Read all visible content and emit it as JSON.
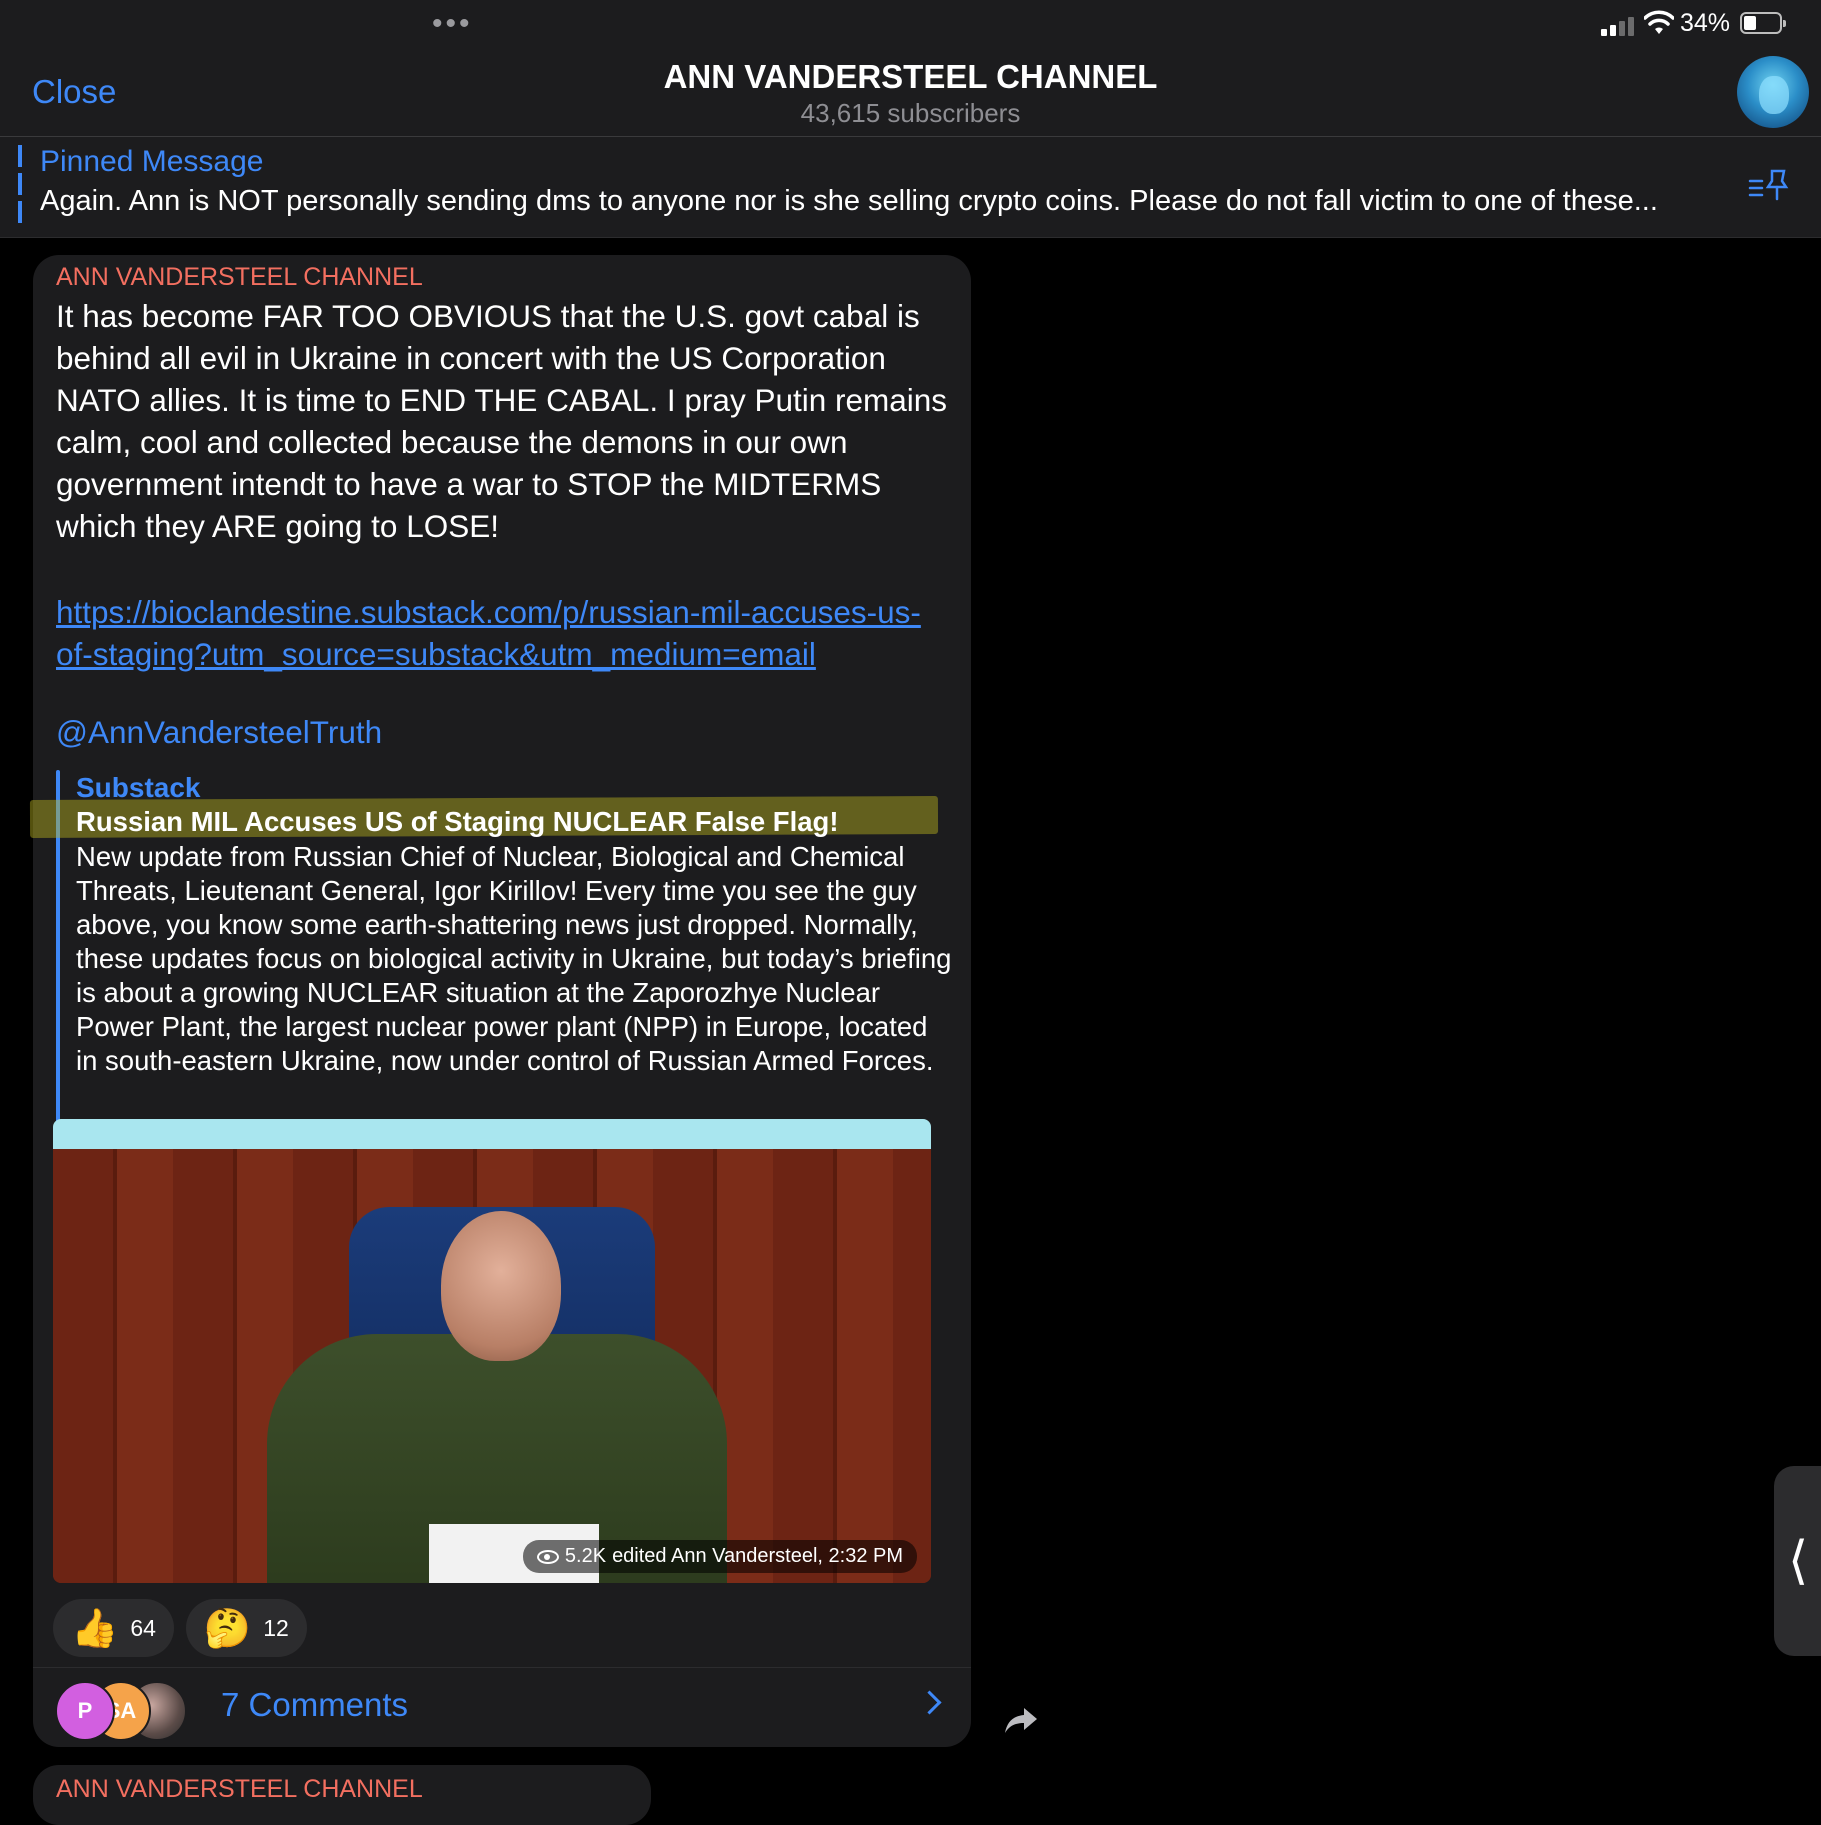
{
  "status_bar": {
    "battery_percent": "34%",
    "battery_level": 0.34
  },
  "header": {
    "close_label": "Close",
    "title": "ANN VANDERSTEEL CHANNEL",
    "subscribers": "43,615 subscribers"
  },
  "pinned": {
    "label": "Pinned Message",
    "text": "Again. Ann is NOT personally sending dms to anyone nor is she selling crypto coins. Please do not fall victim to one of these..."
  },
  "message": {
    "sender": "ANN VANDERSTEEL CHANNEL",
    "text": "It has become FAR TOO OBVIOUS that the U.S. govt cabal is behind all evil in Ukraine in concert with the US Corporation NATO allies.  It is time to END THE CABAL.  I pray Putin remains calm, cool and collected because the demons in our own government intendt to have a war to STOP the MIDTERMS which they ARE going to LOSE!",
    "link": "https://bioclandestine.substack.com/p/russian-mil-accuses-us-of-staging?utm_source=substack&utm_medium=email",
    "mention": "@AnnVandersteelTruth",
    "preview": {
      "site": "Substack",
      "title": "Russian MIL Accuses US of Staging NUCLEAR False Flag!",
      "description": "New update from Russian Chief of Nuclear, Biological and Chemical Threats, Lieutenant General, Igor Kirillov! Every time you see the guy above, you know some earth-shattering news just dropped. Normally, these updates focus on biological activity in Ukraine, but today’s briefing is about a growing NUCLEAR situation at the Zaporozhye Nuclear Power Plant, the largest nuclear power plant (NPP) in Europe, located in south-eastern Ukraine, now under control of Russian Armed Forces.",
      "image_views": "5.2K",
      "image_meta": "edited Ann Vandersteel, 2:32 PM"
    },
    "reactions": [
      {
        "emoji": "👍",
        "count": "64"
      },
      {
        "emoji": "🤔",
        "count": "12"
      }
    ],
    "comments": {
      "avatars": [
        "P",
        "SA",
        ""
      ],
      "label": "7 Comments"
    }
  },
  "next_message": {
    "sender": "ANN VANDERSTEEL CHANNEL"
  },
  "side_handle": {
    "glyph": "⟨"
  },
  "colors": {
    "accent": "#3e88f7",
    "sender": "#f36f60",
    "bubble": "#1c1c1e",
    "background": "#000000"
  },
  "icons": [
    "more-dots-icon",
    "signal-icon",
    "wifi-icon",
    "battery-icon",
    "pin-list-icon",
    "eye-icon",
    "chevron-right-icon",
    "share-icon"
  ]
}
